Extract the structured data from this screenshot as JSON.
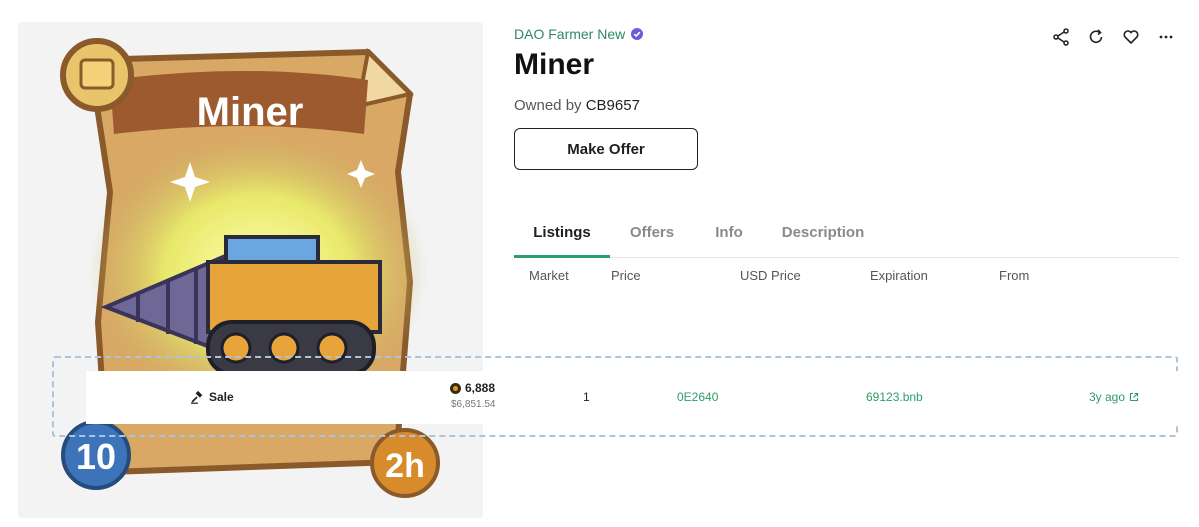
{
  "collection": {
    "name": "DAO Farmer New",
    "verified": true
  },
  "item": {
    "title": "Miner",
    "owned_prefix": "Owned by",
    "owner": "CB9657"
  },
  "card": {
    "title": "Miner",
    "left_value": "10",
    "right_value": "2h"
  },
  "buttons": {
    "make_offer": "Make Offer"
  },
  "actions": [
    "share-icon",
    "refresh-icon",
    "heart-icon",
    "more-icon"
  ],
  "tabs": [
    {
      "label": "Listings",
      "active": true
    },
    {
      "label": "Offers",
      "active": false
    },
    {
      "label": "Info",
      "active": false
    },
    {
      "label": "Description",
      "active": false
    }
  ],
  "columns": [
    "Market",
    "Price",
    "USD Price",
    "Expiration",
    "From"
  ],
  "activity_row": {
    "event": "Sale",
    "price": "6,888",
    "price_usd": "$6,851.54",
    "quantity": "1",
    "from": "0E2640",
    "to": "69123.bnb",
    "time": "3y ago"
  },
  "colors": {
    "accent": "#2e9c6a",
    "link": "#2e8a62",
    "verified": "#6b5bd6"
  }
}
